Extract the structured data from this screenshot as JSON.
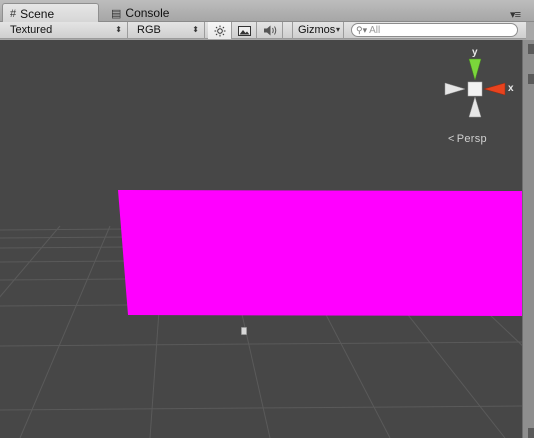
{
  "tabs": [
    {
      "label": "Scene",
      "icon": "grid-icon",
      "active": true
    },
    {
      "label": "Console",
      "icon": "console-icon",
      "active": false
    }
  ],
  "window_menu_icon": "menu-icon",
  "toolbar": {
    "render_mode": "Textured",
    "color_channel": "RGB",
    "lighting_icon": "sun-icon",
    "effects_icon": "image-icon",
    "audio_icon": "speaker-icon",
    "gizmos_label": "Gizmos",
    "search_placeholder": "All"
  },
  "viewport": {
    "background": "#474747",
    "plane_color": "#ff00ff",
    "gizmo": {
      "y_label": "y",
      "x_label": "x",
      "y_color": "#7bd63b",
      "x_color": "#e8431e"
    },
    "projection_label": "Persp"
  }
}
